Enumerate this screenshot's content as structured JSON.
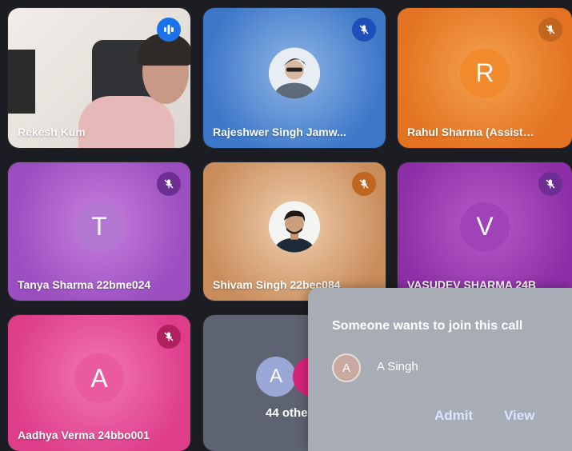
{
  "participants": [
    {
      "name": "Rekesh Kum",
      "type": "video",
      "mic": "speaking"
    },
    {
      "name": "Rajeshwer Singh Jamw...",
      "type": "photo",
      "mic": "muted"
    },
    {
      "name": "Rahul Sharma (Assistan...",
      "type": "letter",
      "initial": "R",
      "mic": "muted"
    },
    {
      "name": "Tanya Sharma 22bme024",
      "type": "letter",
      "initial": "T",
      "mic": "muted"
    },
    {
      "name": "Shivam Singh 22bec084",
      "type": "photo",
      "mic": "muted"
    },
    {
      "name": "VASUDEV SHARMA 24B",
      "type": "letter",
      "initial": "V",
      "mic": "muted"
    },
    {
      "name": "Aadhya Verma 24bbo001",
      "type": "letter",
      "initial": "A",
      "mic": "muted"
    }
  ],
  "others_tile": {
    "avatar_initial": "A",
    "count_label": "44 othe"
  },
  "join_request": {
    "title": "Someone wants to join this call",
    "requester_initial": "A",
    "requester_name": "A Singh",
    "admit_label": "Admit",
    "view_label": "View"
  },
  "colors": {
    "background": "#1c1d22",
    "popup": "#a7acb5",
    "mute_blue": "#1e4fb8",
    "mute_orange": "#c0661e",
    "mute_purple": "#6e2e93",
    "mute_pink": "#b0205f",
    "speaking": "#1a73e8"
  },
  "icons": [
    "mic-off-icon",
    "speaking-icon"
  ]
}
